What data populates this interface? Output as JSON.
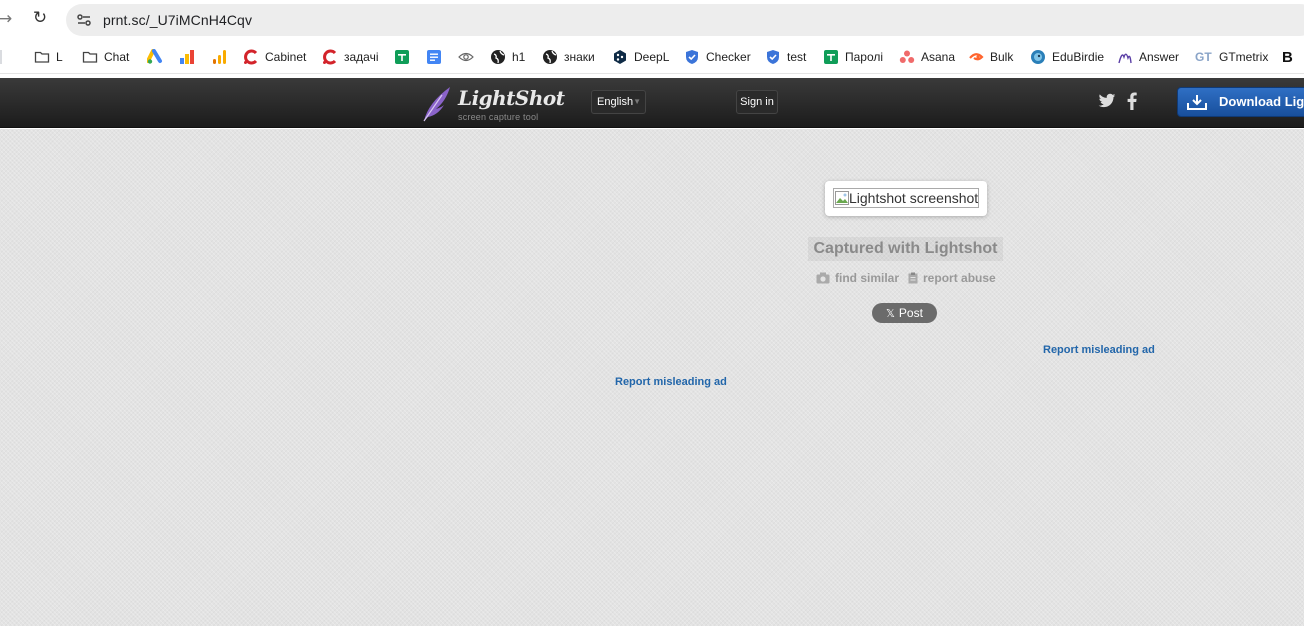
{
  "browser": {
    "url": "prnt.sc/_U7iMCnH4Cqv"
  },
  "bookmarks": [
    {
      "label": "L",
      "icon": "folder-icon"
    },
    {
      "label": "Chat",
      "icon": "folder-icon"
    },
    {
      "label": "",
      "icon": "google-ads-icon"
    },
    {
      "label": "",
      "icon": "analytics-icon"
    },
    {
      "label": "",
      "icon": "analytics-orange-icon"
    },
    {
      "label": "Cabinet",
      "icon": "c-logo-icon"
    },
    {
      "label": "задачі",
      "icon": "c-logo-icon"
    },
    {
      "label": "",
      "icon": "sheets-icon"
    },
    {
      "label": "",
      "icon": "docs-icon"
    },
    {
      "label": "",
      "icon": "eye-icon"
    },
    {
      "label": "h1",
      "icon": "globe-icon"
    },
    {
      "label": "знаки",
      "icon": "globe-icon"
    },
    {
      "label": "DeepL",
      "icon": "deepl-icon"
    },
    {
      "label": "Checker",
      "icon": "shield-icon"
    },
    {
      "label": "test",
      "icon": "shield-icon"
    },
    {
      "label": "Паролі",
      "icon": "sheets-icon"
    },
    {
      "label": "Asana",
      "icon": "asana-icon"
    },
    {
      "label": "Bulk",
      "icon": "semrush-icon"
    },
    {
      "label": "EduBirdie",
      "icon": "edubirdie-icon"
    },
    {
      "label": "Answer",
      "icon": "answer-icon"
    },
    {
      "label": "GTmetrix",
      "icon": "gtmetrix-icon"
    },
    {
      "label": "B",
      "icon": "b-icon"
    }
  ],
  "header": {
    "logo_title": "LightShot",
    "logo_subtitle": "screen capture tool",
    "language": "English",
    "signin": "Sign in",
    "download": "Download Lightshot"
  },
  "main": {
    "screenshot_alt": "Lightshot screenshot",
    "captured": "Captured with Lightshot",
    "find_similar": "find similar",
    "report_abuse": "report abuse",
    "post": "Post",
    "report_ad_right": "Report misleading ad",
    "report_ad_left": "Report misleading ad"
  },
  "colors": {
    "header_bg": "#262626",
    "page_bg": "#e3e3e3",
    "link": "#2266aa",
    "download_button": "#2563b3"
  }
}
